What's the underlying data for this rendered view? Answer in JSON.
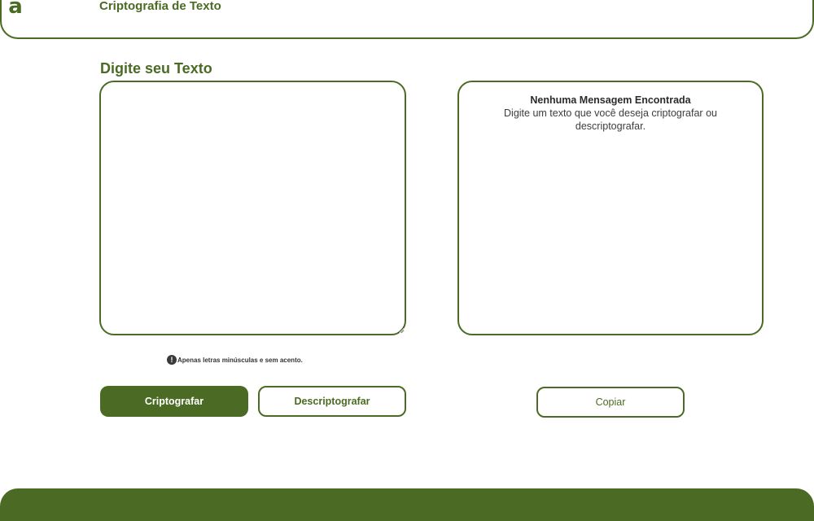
{
  "header": {
    "logo": "a",
    "title": "Criptografia de Texto"
  },
  "input_section": {
    "title": "Digite seu Texto",
    "value": "",
    "placeholder": ""
  },
  "output": {
    "title": "Nenhuma Mensagem Encontrada",
    "description": "Digite um texto que você deseja criptografar ou descriptografar."
  },
  "hint": {
    "icon": "exclamation-circle-icon",
    "icon_glyph": "!",
    "text": "Apenas letras minúsculas e sem acento."
  },
  "buttons": {
    "encrypt": "Criptografar",
    "decrypt": "Descriptografar",
    "copy": "Copiar"
  },
  "colors": {
    "brand": "#4b6b24",
    "text_dark": "#2b2b2b",
    "background": "#ffffff"
  }
}
